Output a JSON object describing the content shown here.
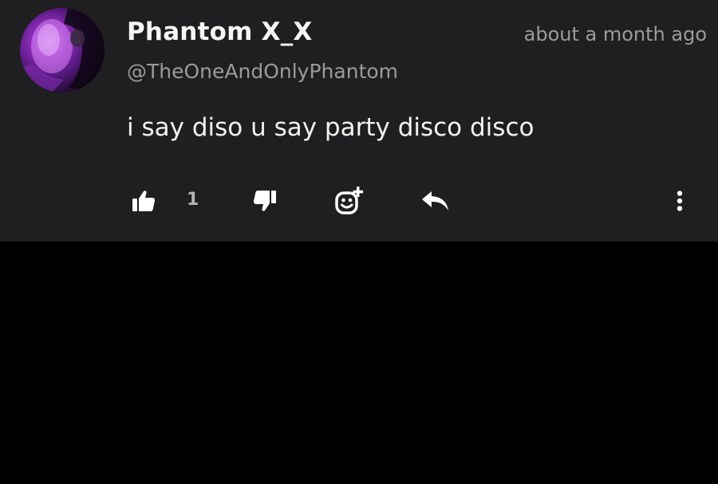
{
  "comment": {
    "author_name": "Phantom X_X",
    "author_handle": "@TheOneAndOnlyPhantom",
    "timestamp": "about a month ago",
    "text": "i say diso u say party disco disco",
    "like_count": "1"
  },
  "icons": {
    "like": "thumbs-up-icon",
    "dislike": "thumbs-down-icon",
    "emoji": "add-reaction-icon",
    "reply": "reply-arrow-icon",
    "more": "more-vertical-icon"
  },
  "colors": {
    "card_background": "#1f1e20",
    "page_background": "#000000",
    "primary_text": "#f5f5f5",
    "secondary_text": "#9b9b9b",
    "avatar_accent": "#c46be8"
  }
}
